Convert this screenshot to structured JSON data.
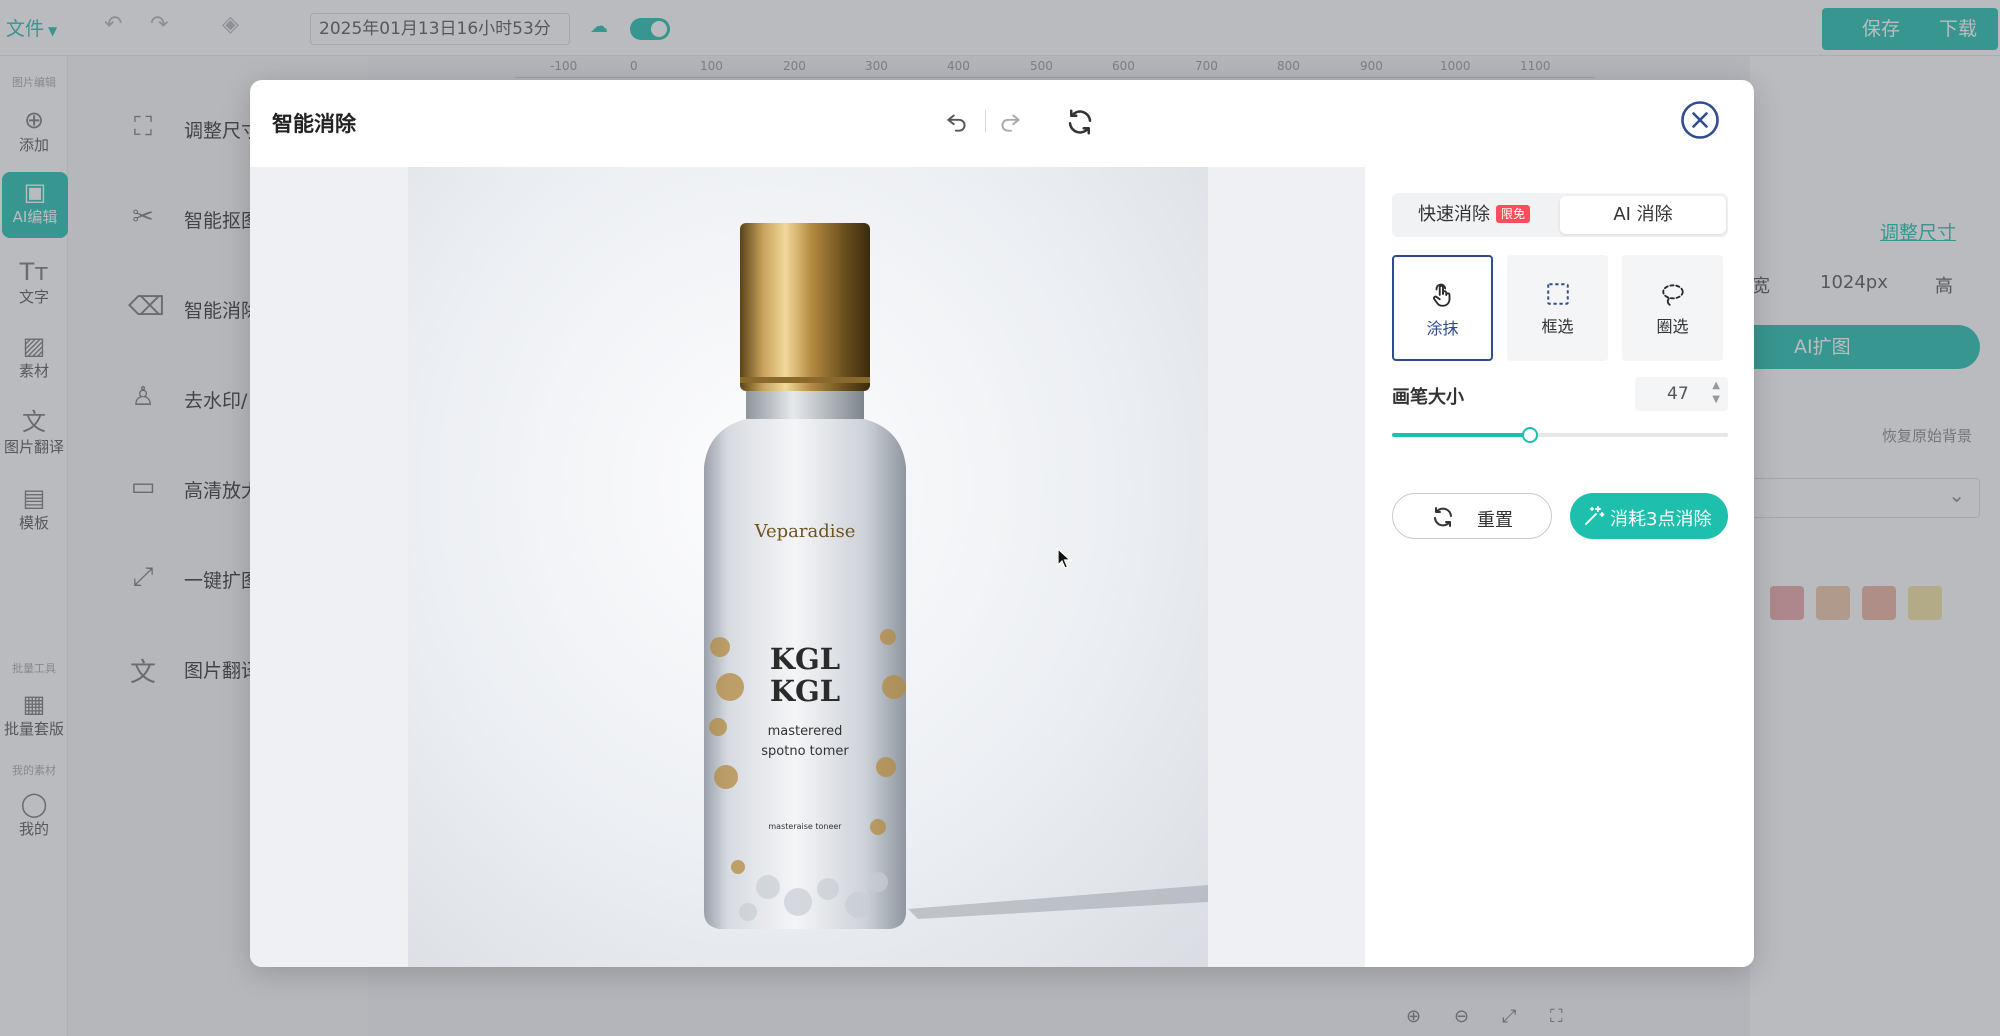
{
  "editor": {
    "file_menu": "文件",
    "doc_name": "2025年01月13日16小时53分",
    "save": "保存",
    "download": "下载",
    "ruler": [
      "-100",
      "0",
      "100",
      "200",
      "300",
      "400",
      "500",
      "600",
      "700",
      "800",
      "900",
      "1000",
      "1100"
    ],
    "nav_groups": {
      "image_edit": "图片编辑",
      "batch_tools": "批量工具",
      "my_assets": "我的素材"
    },
    "nav": [
      {
        "label": "添加",
        "icon": "plus-circle-icon"
      },
      {
        "label": "AI编辑",
        "icon": "ai-icon"
      },
      {
        "label": "文字",
        "icon": "text-icon"
      },
      {
        "label": "素材",
        "icon": "image-icon"
      },
      {
        "label": "图片翻译",
        "icon": "translate-icon"
      },
      {
        "label": "模板",
        "icon": "template-icon"
      },
      {
        "label": "批量套版",
        "icon": "grid-icon"
      },
      {
        "label": "我的",
        "icon": "user-icon"
      }
    ],
    "tools": [
      {
        "label": "调整尺寸",
        "icon": "crop-icon"
      },
      {
        "label": "智能抠图",
        "icon": "scissors-icon"
      },
      {
        "label": "智能消除",
        "icon": "eraser-icon"
      },
      {
        "label": "去水印/",
        "icon": "stamp-icon"
      },
      {
        "label": "高清放大",
        "icon": "hd-icon"
      },
      {
        "label": "一键扩图",
        "icon": "expand-icon"
      },
      {
        "label": "图片翻译",
        "icon": "translate-icon"
      }
    ],
    "right": {
      "resize_link": "调整尺寸",
      "width_label": "宽",
      "width_value": "1024px",
      "height_label": "高",
      "ai_expand": "AI扩图",
      "restore_bg": "恢复原始背景",
      "swatches": [
        "#e8a5a8",
        "#ecc7a8",
        "#eeb1a1",
        "#f3e3a0"
      ]
    }
  },
  "modal": {
    "title": "智能消除",
    "tabs": {
      "quick": "快速消除",
      "quick_badge": "限免",
      "ai": "AI 消除"
    },
    "modes": [
      {
        "label": "涂抹",
        "icon": "hand-pointer-icon",
        "active": true
      },
      {
        "label": "框选",
        "icon": "dashed-rect-icon",
        "active": false
      },
      {
        "label": "圈选",
        "icon": "lasso-icon",
        "active": false
      }
    ],
    "brush": {
      "label": "画笔大小",
      "value": "47",
      "fraction": 0.41
    },
    "reset": "重置",
    "erase": "消耗3点消除",
    "accent": "#1fbfae",
    "active_border": "#2f4c8e"
  },
  "product": {
    "logo_text": "Veparadise",
    "name_line1": "KGL",
    "name_line2": "KGL",
    "desc_line1": "masterered",
    "desc_line2": "spotno tomer",
    "small_text": "masteraise toneer"
  }
}
